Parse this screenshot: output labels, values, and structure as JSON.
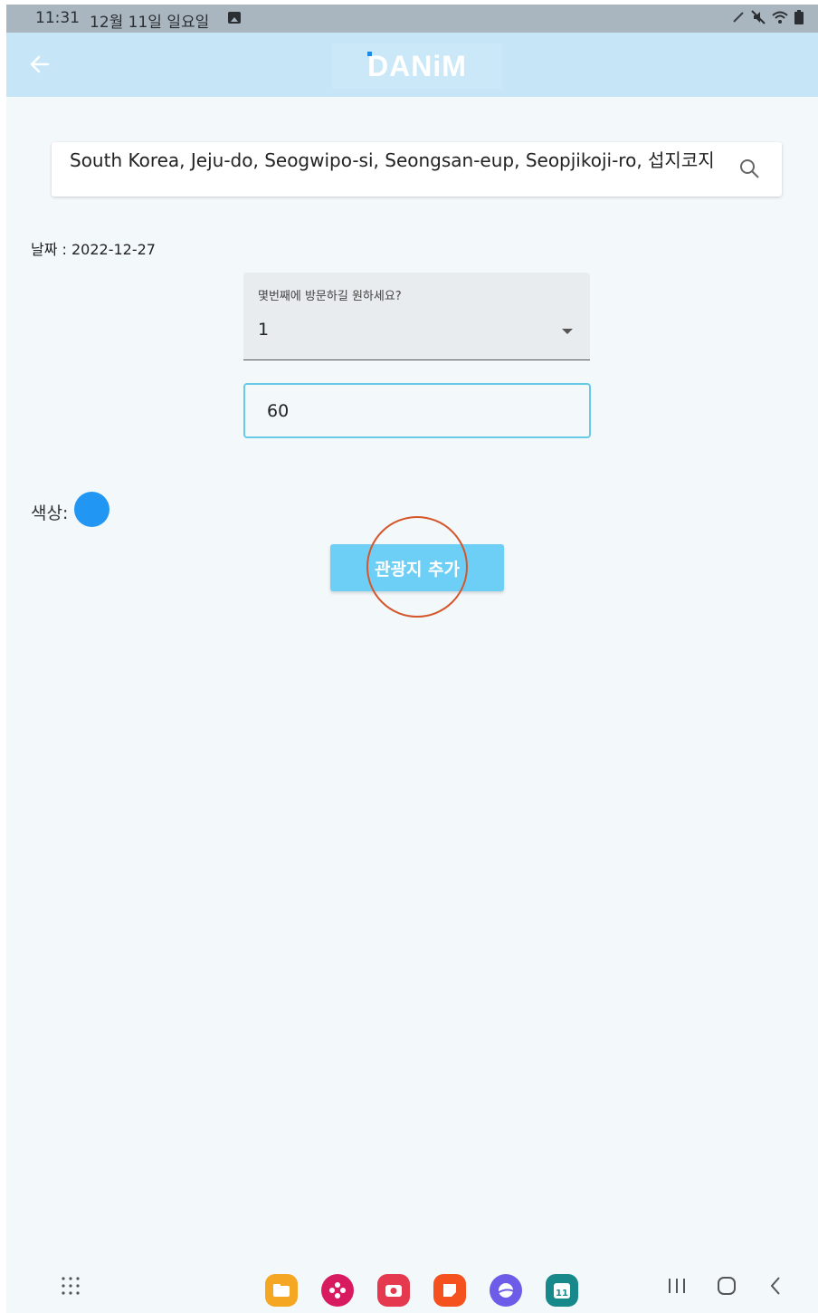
{
  "status_bar": {
    "time": "11:31",
    "date": "12월 11일 일요일"
  },
  "app_bar": {
    "logo": "DANiM"
  },
  "search": {
    "value": "South Korea, Jeju-do, Seogwipo-si, Seongsan-eup, Seopjikoji-ro, 섭지코지"
  },
  "date_line": "날짜 : 2022-12-27",
  "visit_order": {
    "label": "몇번째에 방문하길 원하세요?",
    "selected": "1"
  },
  "duration_input": {
    "value": "60"
  },
  "color": {
    "label": "색상:",
    "value": "#2196f3"
  },
  "add_button": {
    "label": "관광지 추가"
  },
  "colors": {
    "app_bar": "#c6e6f7",
    "button": "#6ecff6",
    "input_border": "#67cbe8",
    "background": "#f3f8fb"
  },
  "dock_apps": [
    {
      "name": "my-files-app-icon",
      "color": "#f5a623"
    },
    {
      "name": "galaxy-store-app-icon",
      "color": "#d81b60"
    },
    {
      "name": "camera-app-icon",
      "color": "#e53950"
    },
    {
      "name": "samsung-notes-app-icon",
      "color": "#f4511e"
    },
    {
      "name": "samsung-internet-app-icon",
      "color": "#6d5ce7"
    },
    {
      "name": "calendar-app-icon",
      "color": "#17898a"
    }
  ],
  "calendar_day": "11"
}
